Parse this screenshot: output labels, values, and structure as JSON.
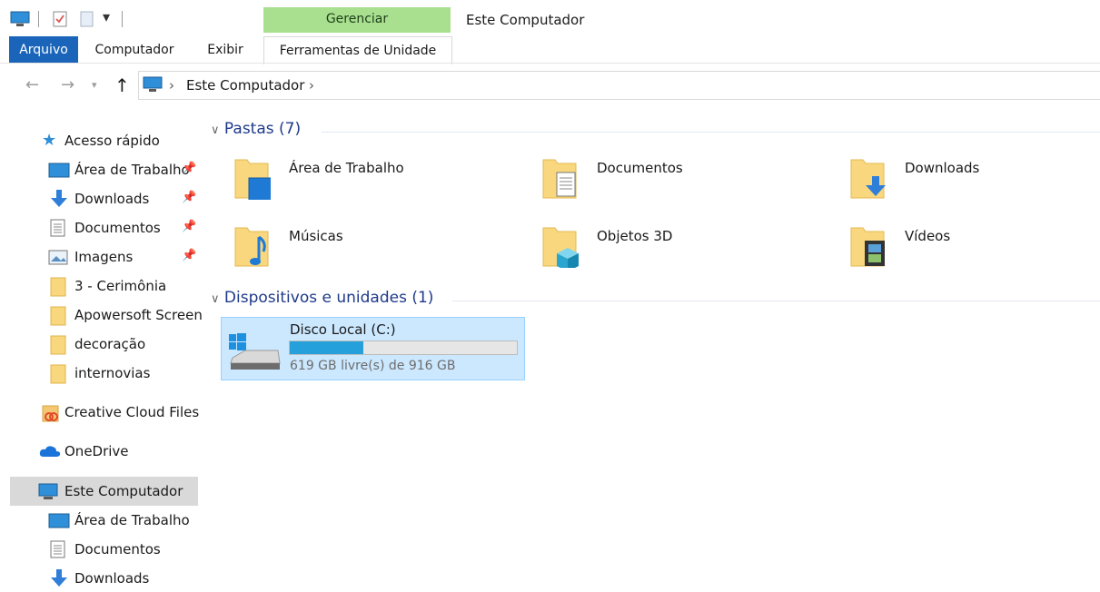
{
  "window": {
    "title": "Este Computador"
  },
  "ribbon": {
    "context_group": "Gerenciar",
    "tabs": [
      "Arquivo",
      "Computador",
      "Exibir",
      "Ferramentas de Unidade"
    ]
  },
  "address": {
    "crumbs": [
      "Este Computador"
    ]
  },
  "nav": {
    "items": [
      {
        "label": "Acesso rápido",
        "icon": "star-icon"
      },
      {
        "label": "Área de Trabalho",
        "icon": "desktop-icon",
        "pinned": true
      },
      {
        "label": "Downloads",
        "icon": "download-arrow-icon",
        "pinned": true
      },
      {
        "label": "Documentos",
        "icon": "document-icon",
        "pinned": true
      },
      {
        "label": "Imagens",
        "icon": "pictures-icon",
        "pinned": true
      },
      {
        "label": "3 - Cerimônia",
        "icon": "folder-icon"
      },
      {
        "label": "Apowersoft Screen",
        "icon": "folder-icon"
      },
      {
        "label": "decoração",
        "icon": "folder-icon"
      },
      {
        "label": "internovias",
        "icon": "folder-icon"
      },
      {
        "label": "Creative Cloud Files",
        "icon": "creative-cloud-icon"
      },
      {
        "label": "OneDrive",
        "icon": "cloud-icon"
      },
      {
        "label": "Este Computador",
        "icon": "computer-icon",
        "selected": true
      },
      {
        "label": "Área de Trabalho",
        "icon": "desktop-icon"
      },
      {
        "label": "Documentos",
        "icon": "document-icon"
      },
      {
        "label": "Downloads",
        "icon": "download-arrow-icon"
      }
    ]
  },
  "content": {
    "folders_header": "Pastas (7)",
    "folders": [
      {
        "label": "Área de Trabalho",
        "overlay": "desktop-icon"
      },
      {
        "label": "Documentos",
        "overlay": "document-icon"
      },
      {
        "label": "Downloads",
        "overlay": "download-arrow-icon"
      },
      {
        "label": "Músicas",
        "overlay": "music-note-icon"
      },
      {
        "label": "Objetos 3D",
        "overlay": "cube-icon"
      },
      {
        "label": "Vídeos",
        "overlay": "film-icon"
      }
    ],
    "devices_header": "Dispositivos e unidades (1)",
    "drive": {
      "name": "Disco Local (C:)",
      "free_text": "619 GB livre(s) de 916 GB",
      "used_fraction": 0.324
    }
  },
  "colors": {
    "accent": "#1a65b9",
    "context_tab": "#a8e08f",
    "selection": "#cce8ff",
    "drive_bar": "#26a0da",
    "group_header": "#1e3a8a"
  }
}
